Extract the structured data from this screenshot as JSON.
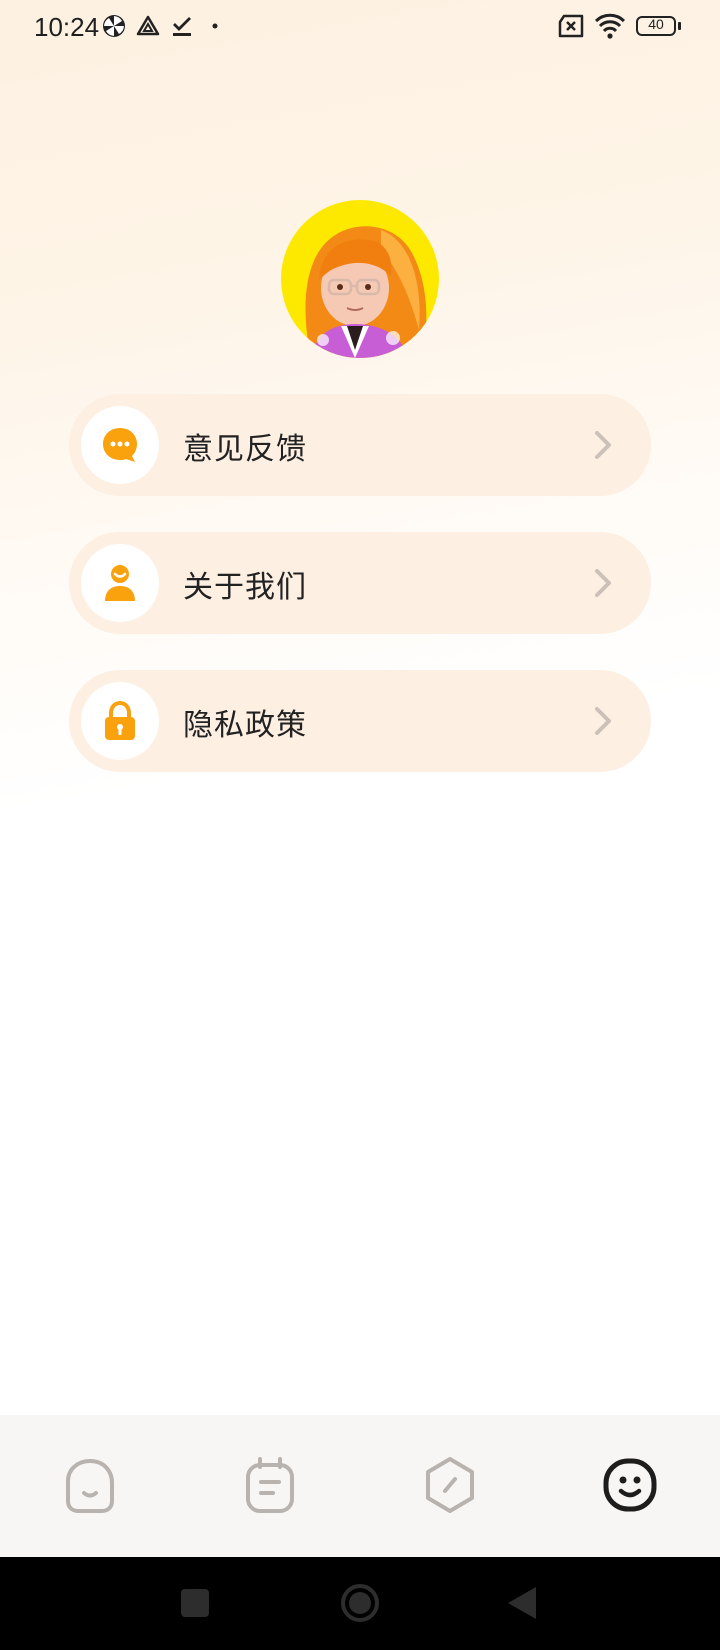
{
  "status_bar": {
    "time": "10:24",
    "battery_level": "40",
    "icons": [
      "pinwheel-icon",
      "drive-icon",
      "task-check-icon",
      "dot-icon",
      "no-sim-icon",
      "wifi-icon",
      "battery-icon"
    ]
  },
  "profile": {
    "avatar_icon": "cartoon-girl-avatar",
    "avatar_bg": "#fde900"
  },
  "menu": {
    "items": [
      {
        "label": "意见反馈",
        "icon": "chat-bubble-icon"
      },
      {
        "label": "关于我们",
        "icon": "person-icon"
      },
      {
        "label": "隐私政策",
        "icon": "lock-icon"
      }
    ],
    "accent_color": "#f9a20e",
    "card_bg": "#fdefe2"
  },
  "tab_bar": {
    "tabs": [
      {
        "icon": "home-face-icon",
        "active": false
      },
      {
        "icon": "notes-icon",
        "active": false
      },
      {
        "icon": "compass-icon",
        "active": false
      },
      {
        "icon": "smiley-icon",
        "active": true
      }
    ]
  },
  "nav_bar": {
    "buttons": [
      "recents-square-icon",
      "home-circle-icon",
      "back-triangle-icon"
    ]
  }
}
